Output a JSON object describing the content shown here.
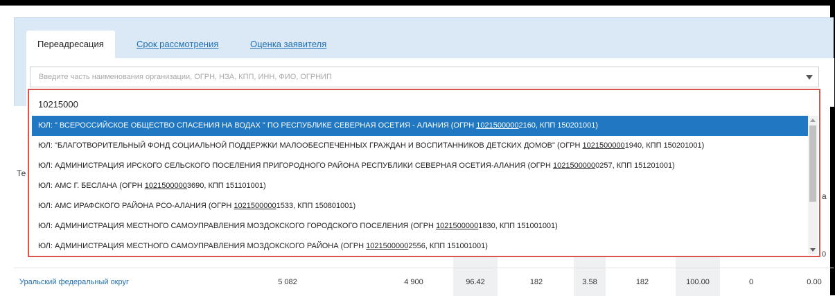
{
  "tabs": [
    {
      "label": "Переадресация"
    },
    {
      "label": "Срок рассмотрения"
    },
    {
      "label": "Оценка заявителя"
    }
  ],
  "org_select": {
    "placeholder": "Введите часть наименования организации, ОГРН, НЗА, КПП, ИНН, ФИО, ОГРНИП",
    "search_value": "10215000"
  },
  "options": [
    {
      "pre": "ЮЛ: \" ВСЕРОССИЙСКОЕ ОБЩЕСТВО СПАСЕНИЯ НА ВОДАХ \" ПО РЕСПУБЛИКЕ СЕВЕРНАЯ ОСЕТИЯ - АЛАНИЯ (ОГРН ",
      "match": "1021500000",
      "post": "2160, КПП 150201001)"
    },
    {
      "pre": "ЮЛ: \"БЛАГОТВОРИТЕЛЬНЫЙ ФОНД СОЦИАЛЬНОЙ ПОДДЕРЖКИ МАЛООБЕСПЕЧЕННЫХ ГРАЖДАН И ВОСПИТАННИКОВ ДЕТСКИХ ДОМОВ\" (ОГРН ",
      "match": "1021500000",
      "post": "1940, КПП 150201001)"
    },
    {
      "pre": "ЮЛ: АДМИНИСТРАЦИЯ ИРСКОГО СЕЛЬСКОГО ПОСЕЛЕНИЯ ПРИГОРОДНОГО РАЙОНА РЕСПУБЛИКИ СЕВЕРНАЯ ОСЕТИЯ-АЛАНИЯ (ОГРН ",
      "match": "1021500000",
      "post": "0257, КПП 151201001)"
    },
    {
      "pre": "ЮЛ: АМС Г. БЕСЛАНА (ОГРН ",
      "match": "1021500000",
      "post": "3690, КПП 151101001)"
    },
    {
      "pre": "ЮЛ: АМС ИРАФСКОГО РАЙОНА РСО-АЛАНИЯ (ОГРН ",
      "match": "1021500000",
      "post": "1533, КПП 150801001)"
    },
    {
      "pre": "ЮЛ: АДМИНИСТРАЦИЯ МЕСТНОГО САМОУПРАВЛЕНИЯ МОЗДОКСКОГО ГОРОДСКОГО ПОСЕЛЕНИЯ (ОГРН ",
      "match": "1021500000",
      "post": "1830, КПП 151001001)"
    },
    {
      "pre": "ЮЛ: АДМИНИСТРАЦИЯ МЕСТНОГО САМОУПРАВЛЕНИЯ МОЗДОКСКОГО РАЙОНА (ОГРН ",
      "match": "1021500000",
      "post": "2556, КПП 151001001)"
    }
  ],
  "behind": {
    "header_fragment": "Те",
    "right_fragment_top": "а",
    "right_fragment_bottom": "0"
  },
  "table_row": {
    "name": "Уральский федеральный округ",
    "cells": [
      "5 082",
      "4 900",
      "96.42",
      "182",
      "3.58",
      "182",
      "100.00",
      "0",
      "0.00"
    ]
  },
  "colors": {
    "selected_bg": "#1f78c1",
    "highlight_border": "#d9534f",
    "link": "#1f6fb5"
  }
}
